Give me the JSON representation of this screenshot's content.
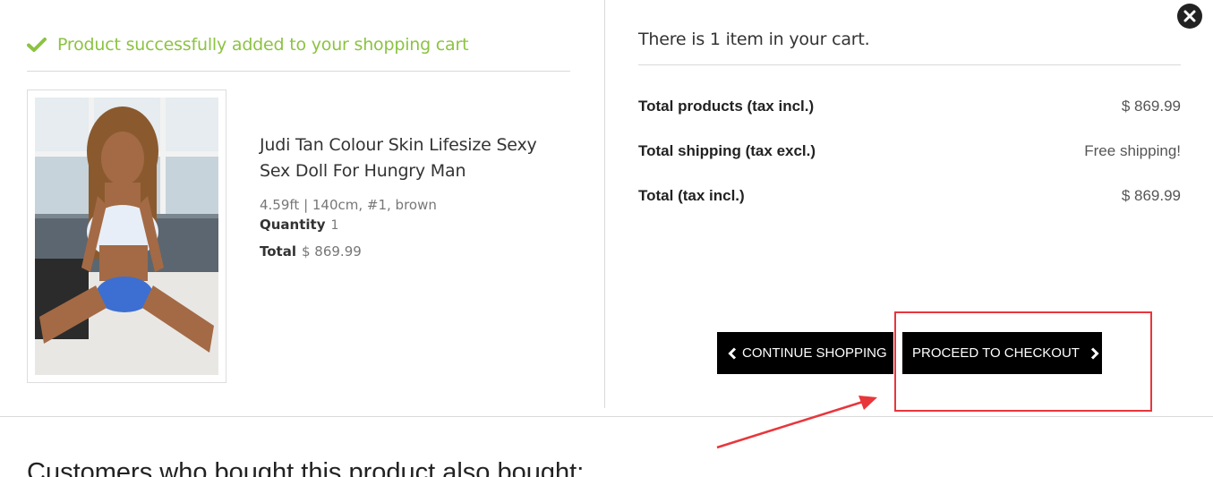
{
  "modal": {
    "close_icon": "close-circle-icon"
  },
  "left": {
    "success_icon": "checkmark-icon",
    "success_message": "Product successfully added to your shopping cart",
    "product": {
      "name": "Judi Tan Colour Skin Lifesize Sexy Sex Doll For Hungry Man",
      "attributes": "4.59ft | 140cm, #1, brown",
      "quantity_label": "Quantity",
      "quantity_value": "1",
      "total_label": "Total",
      "total_value": "$ 869.99"
    }
  },
  "right": {
    "cart_count_text": "There is 1 item in your cart.",
    "summary": [
      {
        "label": "Total products (tax incl.)",
        "value": "$ 869.99"
      },
      {
        "label": "Total shipping (tax excl.)",
        "value": "Free shipping!"
      },
      {
        "label": "Total (tax incl.)",
        "value": "$ 869.99"
      }
    ],
    "continue_button": {
      "label": "CONTINUE SHOPPING",
      "icon": "chevron-left-icon"
    },
    "checkout_button": {
      "label": "PROCEED TO CHECKOUT",
      "icon": "chevron-right-icon"
    }
  },
  "also_bought": {
    "heading": "Customers who bought this product also bought:"
  },
  "colors": {
    "success": "#8cc342",
    "button_bg": "#000000",
    "annotation": "#e8363b"
  }
}
